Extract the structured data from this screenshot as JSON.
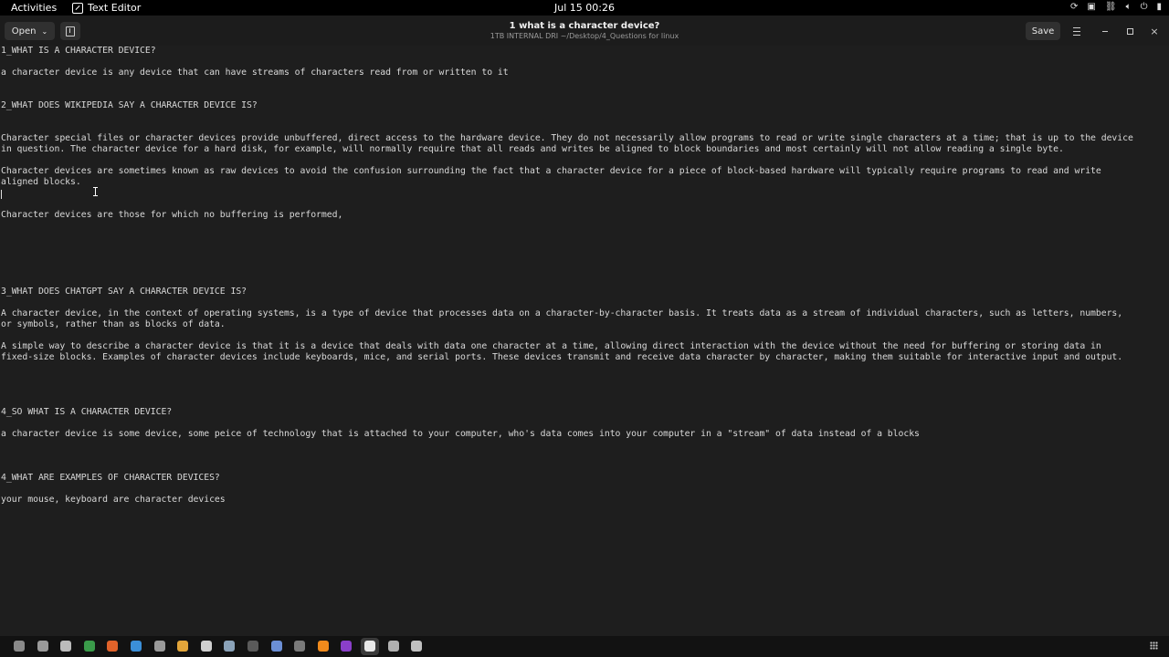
{
  "topbar": {
    "activities": "Activities",
    "app_name": "Text Editor",
    "clock": "Jul 15  00:26",
    "tray_icons": [
      "update-icon",
      "screenshot-icon",
      "network-icon",
      "volume-icon",
      "power-icon",
      "battery-icon"
    ]
  },
  "header": {
    "open_label": "Open",
    "title": "1 what is a character device?",
    "subtitle": "1TB INTERNAL DRI ~/Desktop/4_Questions for linux",
    "save_label": "Save"
  },
  "editor": {
    "lines": [
      "1_WHAT IS A CHARACTER DEVICE?",
      "a character device is any device that can have streams of characters read from or written to it",
      "2_WHAT DOES WIKIPEDIA SAY A CHARACTER DEVICE IS?",
      "Character special files or character devices provide unbuffered, direct access to the hardware device. They do not necessarily allow programs to read or write single characters at a time; that is up to the device",
      "in question. The character device for a hard disk, for example, will normally require that all reads and writes be aligned to block boundaries and most certainly will not allow reading a single byte.",
      "Character devices are sometimes known as raw devices to avoid the confusion surrounding the fact that a character device for a piece of block-based hardware will typically require programs to read and write",
      "aligned blocks.",
      "Character devices are those for which no buffering is performed,",
      "3_WHAT DOES CHATGPT SAY A CHARACTER DEVICE IS?",
      "A character device, in the context of operating systems, is a type of device that processes data on a character-by-character basis. It treats data as a stream of individual characters, such as letters, numbers,",
      "or symbols, rather than as blocks of data.",
      "A simple way to describe a character device is that it is a device that deals with data one character at a time, allowing direct interaction with the device without the need for buffering or storing data in",
      "fixed-size blocks. Examples of character devices include keyboards, mice, and serial ports. These devices transmit and receive data character by character, making them suitable for interactive input and output.",
      "4_SO WHAT IS A CHARACTER DEVICE?",
      "a character device is some device, some peice of technology that is attached to your computer, who's data comes into your computer in a \"stream\" of data instead of a blocks",
      "4_WHAT ARE EXAMPLES OF CHARACTER DEVICES?",
      "your mouse, keyboard are character devices"
    ]
  },
  "dock": {
    "apps": [
      {
        "icon": "screenshot-tool-icon",
        "color": "#8a8a8a"
      },
      {
        "icon": "files-icon",
        "color": "#9a9a9a"
      },
      {
        "icon": "document-viewer-icon",
        "color": "#bbbbbb"
      },
      {
        "icon": "chrome-icon",
        "color": "#3a9b4a"
      },
      {
        "icon": "firefox-icon",
        "color": "#e0622a"
      },
      {
        "icon": "vscode-icon",
        "color": "#3b8fd8"
      },
      {
        "icon": "settings-icon",
        "color": "#9a9a9a"
      },
      {
        "icon": "sublime-icon",
        "color": "#e2a53a"
      },
      {
        "icon": "gear-app-icon",
        "color": "#cfcfcf"
      },
      {
        "icon": "network-tool-icon",
        "color": "#8aa2b8"
      },
      {
        "icon": "terminal-icon",
        "color": "#5a5a5a"
      },
      {
        "icon": "browser-icon",
        "color": "#6b8fd6"
      },
      {
        "icon": "game-icon",
        "color": "#7a7a7a"
      },
      {
        "icon": "vlc-icon",
        "color": "#f08a1c"
      },
      {
        "icon": "app-purple-icon",
        "color": "#8a3fc9"
      },
      {
        "icon": "text-editor-icon",
        "color": "#e8e8e8"
      },
      {
        "icon": "notes-icon",
        "color": "#b0b0b0"
      },
      {
        "icon": "archive-icon",
        "color": "#c0c0c0"
      }
    ],
    "active_app": "text-editor-icon"
  }
}
